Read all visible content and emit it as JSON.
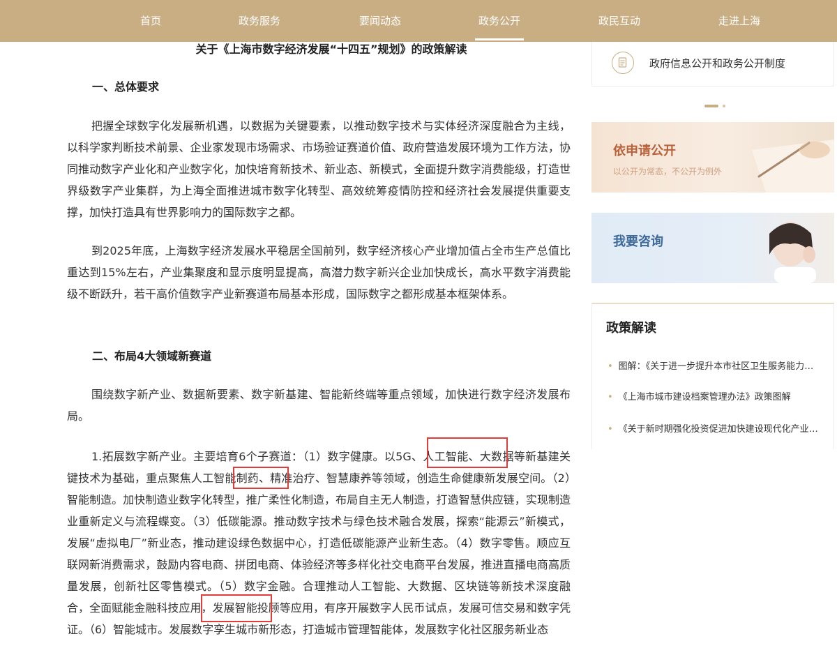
{
  "nav": {
    "items": [
      "首页",
      "政务服务",
      "要闻动态",
      "政务公开",
      "政民互动",
      "走进上海"
    ],
    "active_index": 3
  },
  "article": {
    "title": "关于《上海市数字经济发展“十四五”规划》的政策解读",
    "section1": "一、总体要求",
    "para1": "把握全球数字化发展新机遇，以数据为关键要素，以推动数字技术与实体经济深度融合为主线，以科学家判断技术前景、企业家发现市场需求、市场验证赛道价值、政府营造发展环境为工作方法，协同推动数字产业化和产业数字化，加快培育新技术、新业态、新模式，全面提升数字消费能级，打造世界级数字产业集群，为上海全面推进城市数字化转型、高效统筹疫情防控和经济社会发展提供重要支撑，加快打造具有世界影响力的国际数字之都。",
    "para2": "到2025年底，上海数字经济发展水平稳居全国前列，数字经济核心产业增加值占全市生产总值比重达到15%左右，产业集聚度和显示度明显提高，高潜力数字新兴企业加快成长，高水平数字消费能级不断跃升，若干高价值数字产业新赛道布局基本形成，国际数字之都形成基本框架体系。",
    "section2": "二、布局4大领域新赛道",
    "para3": "围绕数字新产业、数据新要素、数字新基建、智能新终端等重点领域，加快进行数字经济发展布局。",
    "para4": "1.拓展数字新产业。主要培育6个子赛道：（1）数字健康。以5G、人工智能、大数据等新基建关键技术为基础，重点聚焦人工智能制药、精准治疗、智慧康养等领域，创造生命健康新发展空间。（2）智能制造。加快制造业数字化转型，推广柔性化制造，布局自主无人制造，打造智慧供应链，实现制造业重新定义与流程蝶变。（3）低碳能源。推动数字技术与绿色技术融合发展，探索“能源云”新模式，发展“虚拟电厂”新业态，推动建设绿色数据中心，打造低碳能源产业新生态。（4）数字零售。顺应互联网新消费需求，鼓励内容电商、拼团电商、体验经济等多样化社交电商平台发展，推进直播电商高质量发展，创新社区零售模式。（5）数字金融。合理推动人工智能、大数据、区块链等新技术深度融合，全面赋能金融科技应用，发展智能投顾等应用，有序开展数字人民币试点，发展可信交易和数字凭证。（6）智能城市。发展数字孪生城市新形态，打造城市管理智能体，发展数字化社区服务新业态"
  },
  "sidebar": {
    "card_label": "政府信息公开和政务公开制度",
    "banner1_title": "依申请公开",
    "banner1_sub": "以公开为常态，不公开为例外",
    "banner2_title": "我要咨询",
    "policy_title": "政策解读",
    "policy_items": [
      "图解：《关于进一步提升本市社区卫生服务能力的实施意见》",
      "《上海市城市建设档案管理办法》政策图解",
      "《关于新时期强化投资促进加快建设现代化产业体系的政策措施》"
    ]
  },
  "colors": {
    "nav_bg": "#c9ae83",
    "highlight": "#e03c3c",
    "accent": "#c9ae83"
  }
}
